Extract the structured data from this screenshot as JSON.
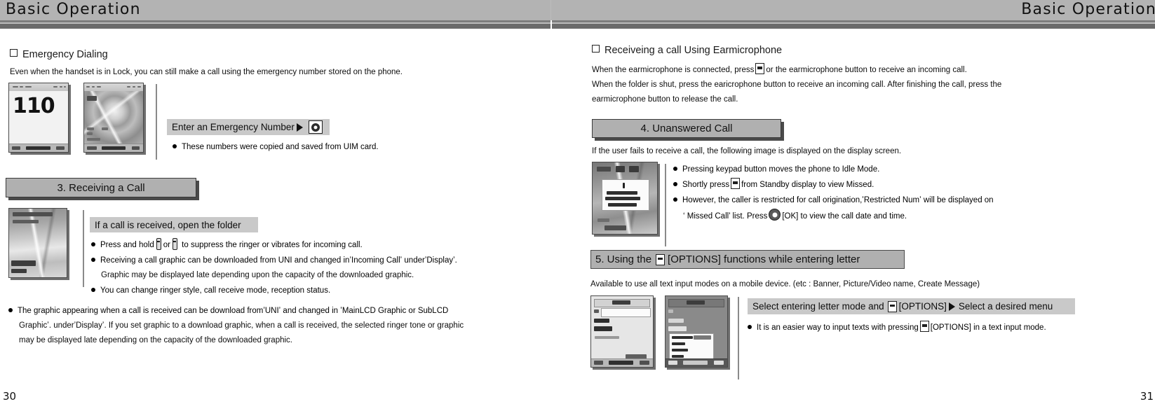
{
  "header": {
    "left_title": "Basic Operation",
    "right_title": "Basic Operation"
  },
  "pages": {
    "left_number": "30",
    "right_number": "31"
  },
  "left_page": {
    "emergency": {
      "heading": "Emergency Dialing",
      "intro": "Even when the handset is in Lock, you can still make a call using the emergency number stored on the phone.",
      "instruction_bar": "Enter an Emergency Number",
      "bullet": "These numbers were copied and saved from UIM card.",
      "phone1_number": "110"
    },
    "receiving": {
      "banner": "3. Receiving a Call",
      "instruction_bar": "If a call is received, open the folder",
      "bullets": [
        {
          "pre": "Press and hold",
          "mid": "or",
          "post": "to suppress the ringer or vibrates for incoming call."
        },
        {
          "text": "Receiving a call graphic can be downloaded from UNI and changed inʼIncoming Callʼ underʼDisplayʼ."
        }
      ],
      "continuation": "Graphic may be displayed late depending upon the capacity of the downloaded graphic.",
      "bullet3": "You can change ringer style, call receive mode, reception status.",
      "note_lines": [
        "The graphic appearing when a call is received can be download fromʼUNIʼ and changed in ʼMainLCD Graphic or SubLCD",
        "Graphicʼ. underʼDisplayʼ. If you set graphic to a download graphic, when a call is received, the selected ringer tone or graphic",
        "may be displayed late depending on the capacity of the downloaded graphic."
      ]
    }
  },
  "right_page": {
    "earmicrophone": {
      "heading": "Receiveing a call Using Earmicrophone",
      "line1_pre": "When the earmicrophone is connected, press",
      "line1_post": "or the earmicrophone button to receive an incoming call.",
      "line2": "When the folder is shut, press the earicrophone button to receive an incoming call. After finishing the call, press the",
      "line3": "earmicrophone button to release the call."
    },
    "unanswered": {
      "banner": "4. Unanswered Call",
      "intro": "If the user fails to receive a call, the following image is displayed on the display screen.",
      "bullet1": "Pressing keypad button moves the phone to Idle Mode.",
      "bullet2_pre": "Shortly press",
      "bullet2_post": "from Standby display to view Missed.",
      "bullet3_line1": "However, the caller is restricted for call origination,ʼRestricted Numʼ will be displayed on",
      "bullet3_line2_pre": "‘ Missed Call’ list. Press",
      "bullet3_line2_post": "[OK] to view the call date and time."
    },
    "options": {
      "banner_pre": "5. Using the",
      "banner_post": "[OPTIONS] functions while entering letter",
      "intro": "Available to use all text input modes on a mobile device. (etc : Banner, Picture/Video name, Create Message)",
      "instruction_pre": "Select entering letter mode and",
      "instruction_mid": "[OPTIONS]",
      "instruction_post": "Select a desired menu",
      "bullet_pre": "It is an easier way to input texts with pressing",
      "bullet_post": "[OPTIONS] in a text input mode."
    }
  },
  "colors": {
    "header_band": "#b3b3b3",
    "header_rule": "#6b6b6b",
    "banner_fill": "#b0b0b0",
    "gray_bar": "#c9c9c9"
  }
}
